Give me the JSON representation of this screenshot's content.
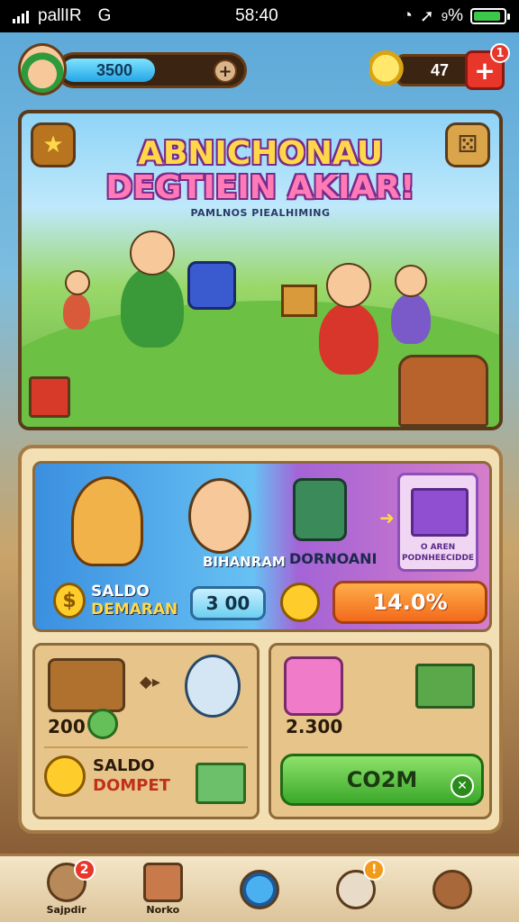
{
  "status_bar": {
    "carrier": "pallIR",
    "network": "G",
    "time": "58:40",
    "battery_text": "%",
    "battery_level_percent": 90
  },
  "hud": {
    "coin_value": "3500",
    "coin_bar_fill_fraction": 0.5,
    "add_symbol": "+",
    "gem_value": "47",
    "plus_symbol": "+",
    "notification_count": "1"
  },
  "banner": {
    "title_line1": "ABNICHONAU",
    "title_line2": "DEGTIEIN AKIAR!",
    "subtitle": "PAMLNOS PIEALHIMING"
  },
  "reward_card": {
    "label_bih": "BIHANRAM",
    "label_dorm": "DORNOANI",
    "mystery_title": "O AREN",
    "mystery_subtitle": "PODNHEECIDDE",
    "saldo_title": "SALDO",
    "saldo_sub": "DEMARAN",
    "value_pill": "3 00",
    "percent_button": "14.0%"
  },
  "wallet_card": {
    "value": "200",
    "arrows": "◆▸",
    "saldo_title": "SALDO",
    "saldo_sub": "DOMPET"
  },
  "shop_card": {
    "value": "2.300",
    "button_label": "CO2M"
  },
  "bottom_nav": {
    "items": [
      {
        "label": "Sajpdir",
        "badge": "2",
        "icon": "house-icon"
      },
      {
        "label": "Norko",
        "badge": "",
        "icon": "box-icon"
      },
      {
        "label": "",
        "badge": "",
        "icon": "globe-icon"
      },
      {
        "label": "",
        "badge": "!",
        "icon": "chat-icon"
      },
      {
        "label": "",
        "badge": "",
        "icon": "shop-icon"
      }
    ]
  },
  "colors": {
    "accent_orange": "#f26a1b",
    "accent_green": "#3aa82a",
    "accent_red": "#e8372a",
    "panel_bg": "#f2dfb4"
  }
}
